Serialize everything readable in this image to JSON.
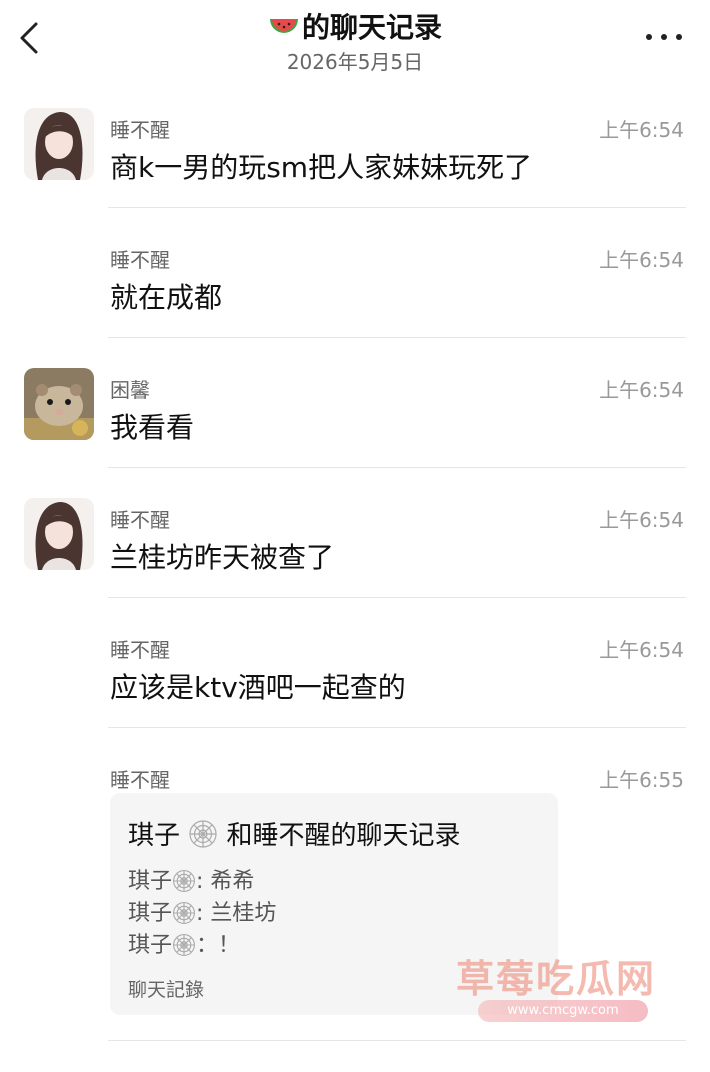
{
  "header": {
    "title": "的聊天记录",
    "title_icon": "watermelon-icon",
    "date": "2026年5月5日",
    "back_icon": "chevron-left-icon",
    "more_icon": "more-dots-icon"
  },
  "messages": [
    {
      "sender": "睡不醒",
      "time": "上午6:54",
      "text": "商k一男的玩sm把人家妹妹玩死了",
      "avatar": "anime-girl-avatar"
    },
    {
      "sender": "睡不醒",
      "time": "上午6:54",
      "text": "就在成都"
    },
    {
      "sender": "困馨",
      "time": "上午6:54",
      "text": "我看看",
      "avatar": "hamster-avatar"
    },
    {
      "sender": "睡不醒",
      "time": "上午6:54",
      "text": "兰桂坊昨天被查了",
      "avatar": "anime-girl-avatar"
    },
    {
      "sender": "睡不醒",
      "time": "上午6:54",
      "text": "应该是ktv酒吧一起查的"
    },
    {
      "sender": "睡不醒",
      "time": "上午6:55"
    }
  ],
  "card": {
    "title_prefix": "琪子",
    "title_suffix": "和睡不醒的聊天记录",
    "lines": [
      {
        "name": "琪子",
        "text": ": 希希"
      },
      {
        "name": "琪子",
        "text": ": 兰桂坊"
      },
      {
        "name": "琪子",
        "text": "：！"
      }
    ],
    "footer": "聊天記錄",
    "emoji_icon": "spiderweb-icon"
  },
  "watermark": {
    "text": "草莓吃瓜网",
    "url": "www.cmcgw.com"
  },
  "colors": {
    "background": "#ffffff",
    "card_bg": "#f5f5f5",
    "meta_text": "#999999"
  }
}
